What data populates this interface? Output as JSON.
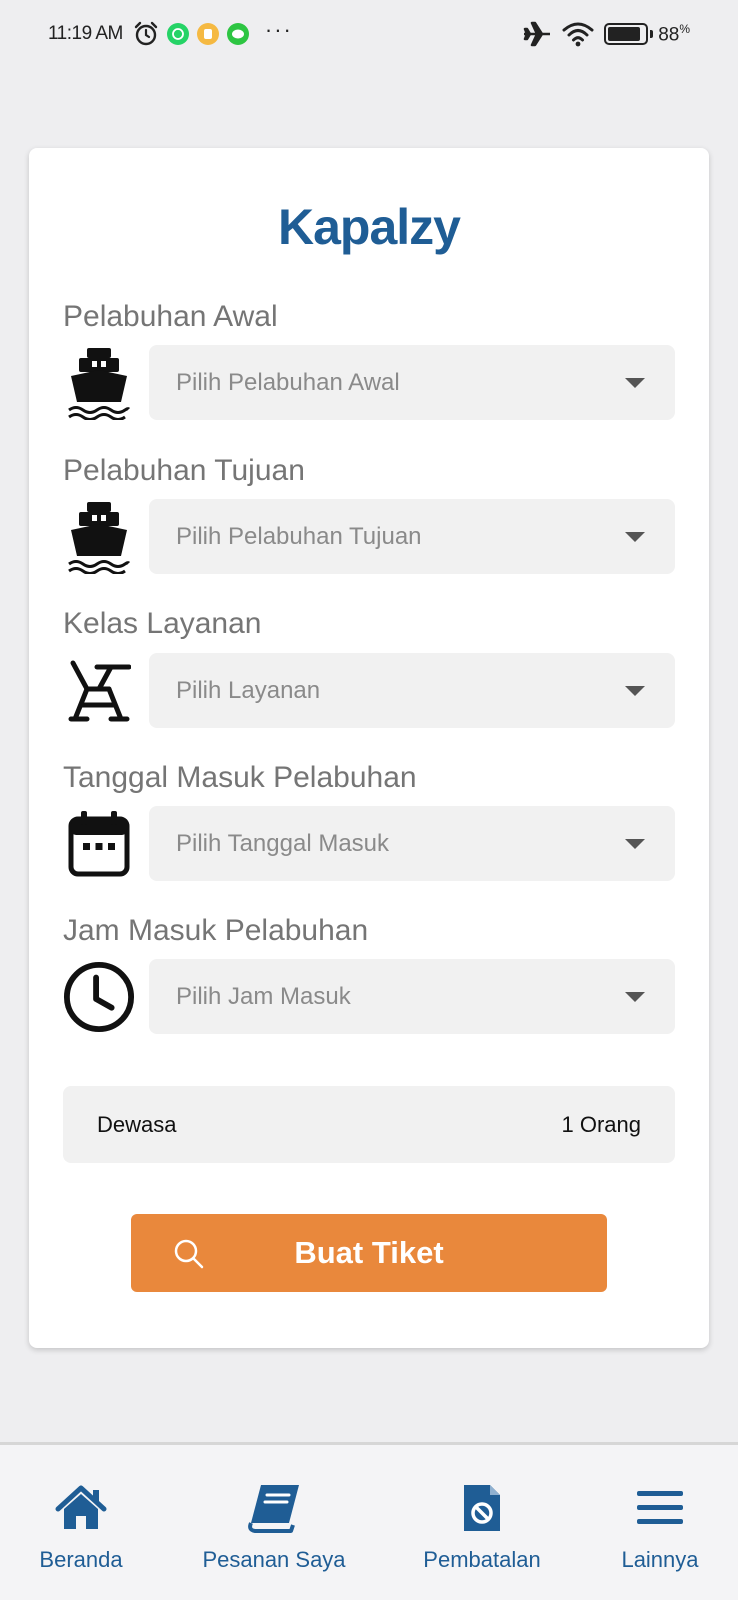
{
  "status_bar": {
    "time": "11:19 AM",
    "battery_percent_value": "88",
    "battery_percent_sign": "%",
    "battery_level": 0.88,
    "more_indicator": "···",
    "icons": [
      "alarm-icon",
      "whatsapp-icon",
      "notification-app-icon",
      "line-app-icon",
      "airplane-icon",
      "wifi-icon",
      "battery-icon"
    ]
  },
  "app": {
    "title": "Kapalzy",
    "brand_color": "#1f5d95",
    "accent_color": "#e9883c"
  },
  "form": {
    "fields": [
      {
        "label": "Pelabuhan Awal",
        "placeholder": "Pilih Pelabuhan Awal",
        "icon": "ship-icon"
      },
      {
        "label": "Pelabuhan Tujuan",
        "placeholder": "Pilih Pelabuhan Tujuan",
        "icon": "ship-icon"
      },
      {
        "label": "Kelas Layanan",
        "placeholder": "Pilih Layanan",
        "icon": "seat-icon"
      },
      {
        "label": "Tanggal Masuk Pelabuhan",
        "placeholder": "Pilih Tanggal Masuk",
        "icon": "calendar-icon"
      },
      {
        "label": "Jam Masuk Pelabuhan",
        "placeholder": "Pilih Jam Masuk",
        "icon": "clock-icon"
      }
    ],
    "passenger": {
      "label": "Dewasa",
      "value": "1 Orang"
    },
    "submit": {
      "label": "Buat Tiket",
      "icon": "search-icon"
    }
  },
  "bottom_nav": {
    "items": [
      {
        "label": "Beranda",
        "icon": "home-icon"
      },
      {
        "label": "Pesanan Saya",
        "icon": "book-icon"
      },
      {
        "label": "Pembatalan",
        "icon": "cancel-document-icon"
      },
      {
        "label": "Lainnya",
        "icon": "menu-icon"
      }
    ]
  }
}
